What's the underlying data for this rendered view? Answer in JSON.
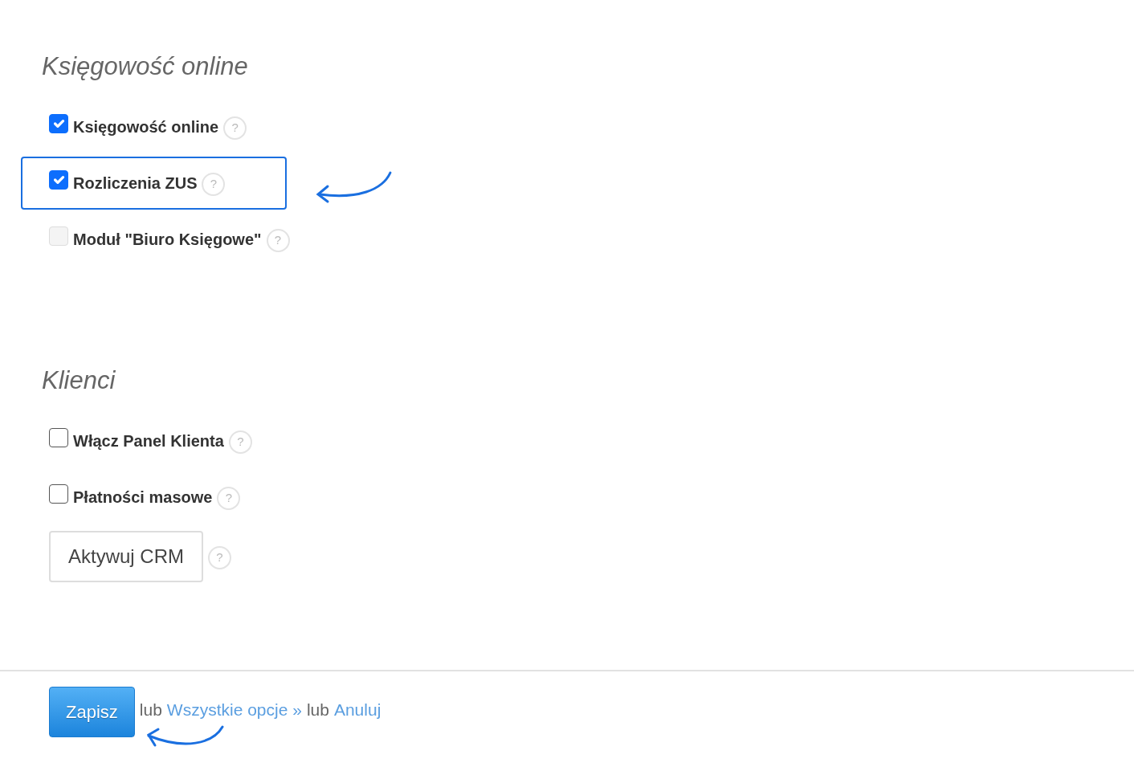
{
  "sections": [
    {
      "title": "Księgowość online",
      "items": [
        {
          "kind": "checkbox",
          "label": "Księgowość online",
          "checked": true,
          "disabled": false,
          "highlighted": false,
          "help": "?"
        },
        {
          "kind": "checkbox",
          "label": "Rozliczenia ZUS",
          "checked": true,
          "disabled": false,
          "highlighted": true,
          "help": "?"
        },
        {
          "kind": "checkbox",
          "label": "Moduł \"Biuro Księgowe\"",
          "checked": false,
          "disabled": true,
          "highlighted": false,
          "help": "?"
        }
      ]
    },
    {
      "title": "Klienci",
      "items": [
        {
          "kind": "checkbox",
          "label": "Włącz Panel Klienta",
          "checked": false,
          "disabled": false,
          "highlighted": false,
          "help": "?"
        },
        {
          "kind": "checkbox",
          "label": "Płatności masowe",
          "checked": false,
          "disabled": false,
          "highlighted": false,
          "help": "?"
        },
        {
          "kind": "button",
          "label": "Aktywuj CRM",
          "highlighted": false,
          "help": "?"
        }
      ]
    }
  ],
  "footer": {
    "save": "Zapisz",
    "parts": [
      {
        "kind": "text",
        "text": "lub"
      },
      {
        "kind": "link",
        "text": "Wszystkie opcje »"
      },
      {
        "kind": "text",
        "text": "lub"
      },
      {
        "kind": "link",
        "text": "Anuluj"
      }
    ]
  }
}
